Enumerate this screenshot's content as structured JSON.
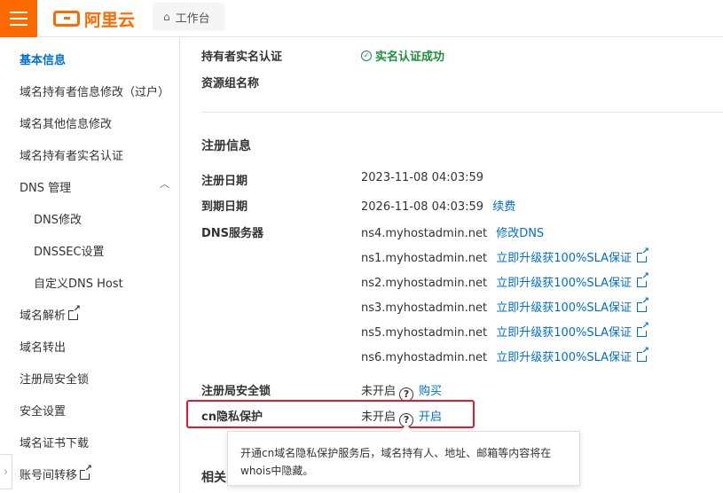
{
  "header": {
    "logo_text": "阿里云",
    "workbench_label": "工作台"
  },
  "sidebar": {
    "items": [
      {
        "label": "基本信息"
      },
      {
        "label": "域名持有者信息修改（过户）"
      },
      {
        "label": "域名其他信息修改"
      },
      {
        "label": "域名持有者实名认证"
      },
      {
        "label": "DNS 管理"
      },
      {
        "label": "DNS修改"
      },
      {
        "label": "DNSSEC设置"
      },
      {
        "label": "自定义DNS Host"
      },
      {
        "label": "域名解析"
      },
      {
        "label": "域名转出"
      },
      {
        "label": "注册局安全锁"
      },
      {
        "label": "安全设置"
      },
      {
        "label": "域名证书下载"
      },
      {
        "label": "账号间转移"
      }
    ]
  },
  "info": {
    "realname_label": "持有者实名认证",
    "realname_value": "实名认证成功",
    "resource_group_label": "资源组名称"
  },
  "registration": {
    "title": "注册信息",
    "reg_date_label": "注册日期",
    "reg_date_value": "2023-11-08 04:03:59",
    "exp_date_label": "到期日期",
    "exp_date_value": "2026-11-08 04:03:59",
    "renew_link": "续费",
    "dns_label": "DNS服务器",
    "dns_servers": [
      {
        "host": "ns4.myhostadmin.net",
        "action": "修改DNS"
      },
      {
        "host": "ns1.myhostadmin.net",
        "action": "立即升级获100%SLA保证"
      },
      {
        "host": "ns2.myhostadmin.net",
        "action": "立即升级获100%SLA保证"
      },
      {
        "host": "ns3.myhostadmin.net",
        "action": "立即升级获100%SLA保证"
      },
      {
        "host": "ns5.myhostadmin.net",
        "action": "立即升级获100%SLA保证"
      },
      {
        "host": "ns6.myhostadmin.net",
        "action": "立即升级获100%SLA保证"
      }
    ],
    "lock_label": "注册局安全锁",
    "lock_status": "未开启",
    "lock_action": "购买",
    "privacy_label": "cn隐私保护",
    "privacy_status": "未开启",
    "privacy_action": "开启"
  },
  "tooltip": {
    "text": "开通cn域名隐私保护服务后，域名持有人、地址、邮箱等内容将在whois中隐藏。"
  },
  "related_title": "相关"
}
